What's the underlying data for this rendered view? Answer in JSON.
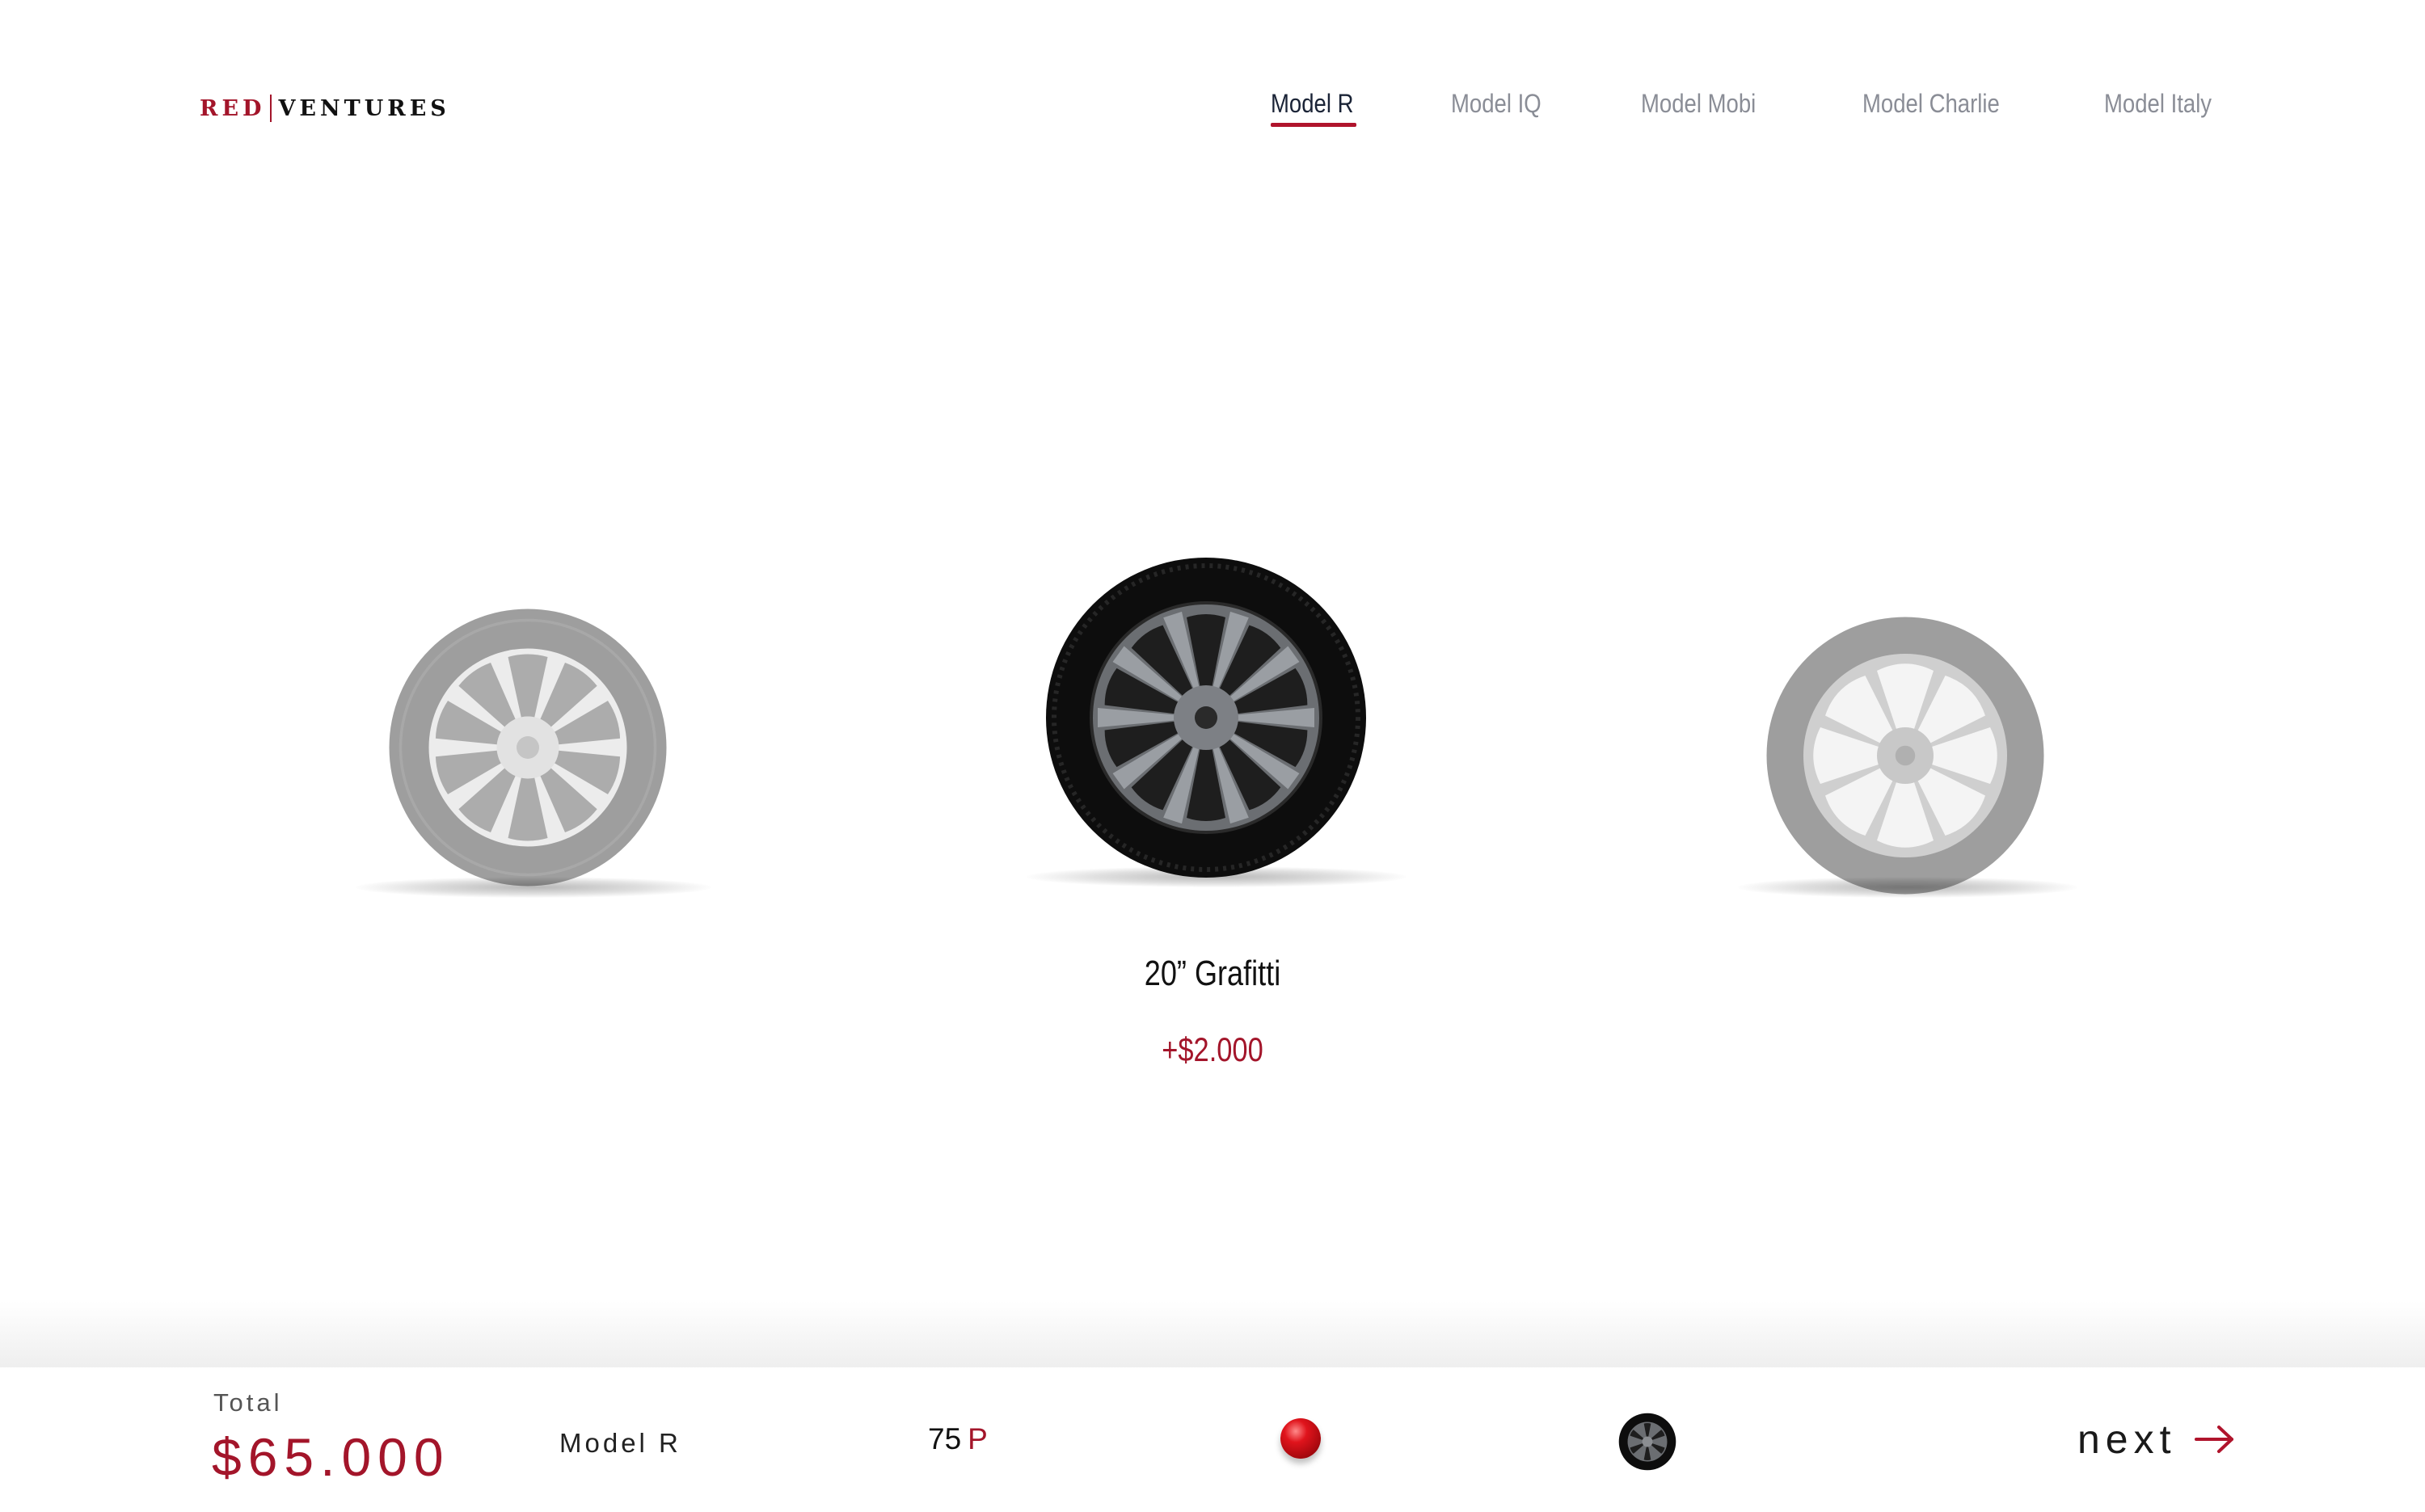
{
  "brand": {
    "part1": "RED",
    "part2": "VENTURES",
    "accent_color": "#a3152a"
  },
  "nav": {
    "items": [
      {
        "label": "Model R",
        "active": true
      },
      {
        "label": "Model IQ",
        "active": false
      },
      {
        "label": "Model Mobi",
        "active": false
      },
      {
        "label": "Model Charlie",
        "active": false
      },
      {
        "label": "Model Italy",
        "active": false
      }
    ]
  },
  "carousel": {
    "selected": {
      "name": "20” Grafitti",
      "price": "+$2.000"
    },
    "wheels": [
      {
        "icon": "wheel-icon",
        "state": "inactive"
      },
      {
        "icon": "wheel-icon",
        "state": "selected"
      },
      {
        "icon": "wheel-icon",
        "state": "inactive"
      }
    ]
  },
  "summary": {
    "total_label": "Total",
    "total_value": "$65.000",
    "model": "Model R",
    "battery_value": "75",
    "battery_unit": "P",
    "paint_color": "#d4111a",
    "next_label": "next"
  }
}
